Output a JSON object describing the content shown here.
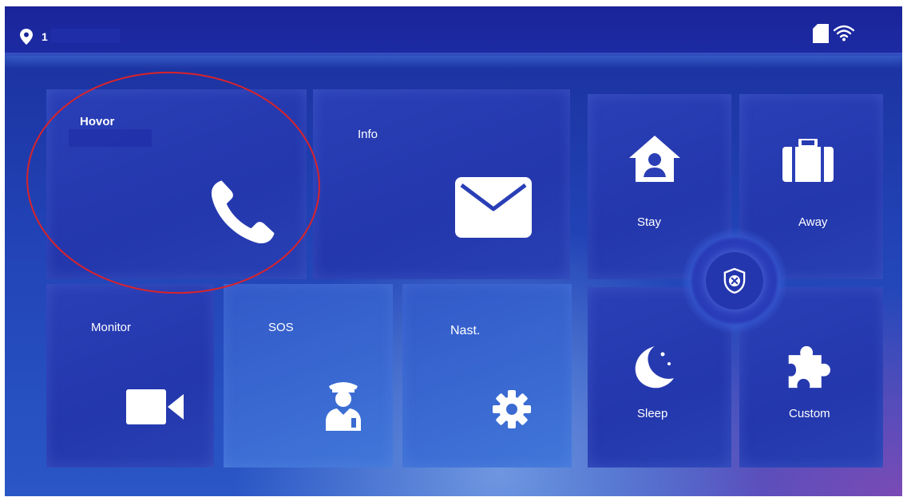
{
  "status": {
    "location_number": "1",
    "icons": [
      "location-icon",
      "sd-card-icon",
      "wifi-icon"
    ]
  },
  "tiles": {
    "call": {
      "label": "Hovor",
      "icon": "phone-icon"
    },
    "info": {
      "label": "Info",
      "icon": "envelope-icon"
    },
    "monitor": {
      "label": "Monitor",
      "icon": "video-camera-icon"
    },
    "sos": {
      "label": "SOS",
      "icon": "security-guard-icon"
    },
    "settings": {
      "label": "Nast.",
      "icon": "gear-icon"
    }
  },
  "arming": {
    "stay": {
      "label": "Stay",
      "icon": "home-person-icon"
    },
    "away": {
      "label": "Away",
      "icon": "suitcase-icon"
    },
    "sleep": {
      "label": "Sleep",
      "icon": "moon-icon"
    },
    "custom": {
      "label": "Custom",
      "icon": "puzzle-icon"
    },
    "disarm": {
      "icon": "shield-x-icon"
    }
  },
  "colors": {
    "background": "#2142b5",
    "status_bar": "#1a249a",
    "highlight_ring": "#d9232a",
    "text": "#ffffff"
  }
}
